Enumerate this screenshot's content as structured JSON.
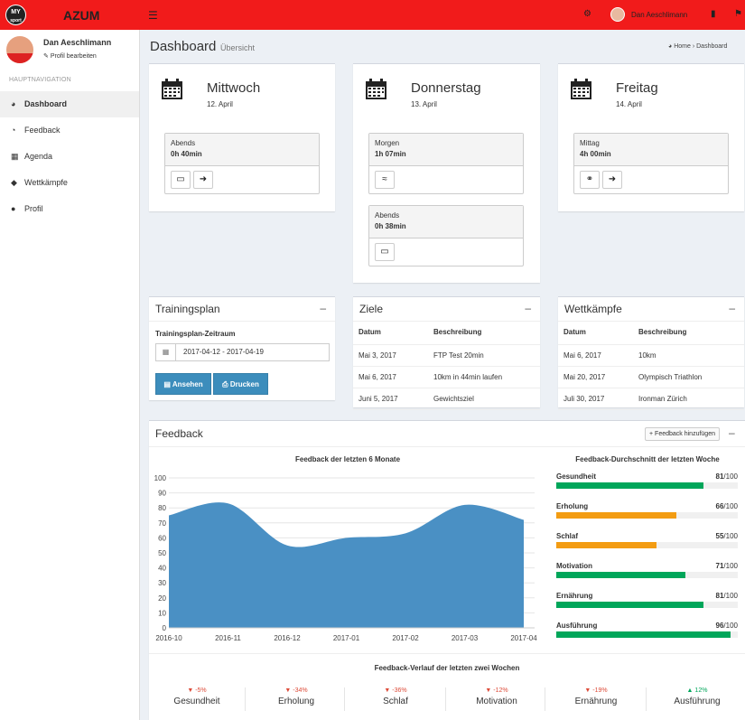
{
  "header": {
    "logo": "MY sport",
    "brand": "AZUM",
    "user_name": "Dan Aeschlimann"
  },
  "sidebar": {
    "user_name": "Dan Aeschlimann",
    "edit_profile": "Profil bearbeiten",
    "section": "HAUPTNAVIGATION",
    "items": [
      {
        "label": "Dashboard",
        "icon": "dashboard-icon",
        "active": true
      },
      {
        "label": "Feedback",
        "icon": "pie-chart-icon",
        "active": false
      },
      {
        "label": "Agenda",
        "icon": "calendar-icon",
        "active": false
      },
      {
        "label": "Wettkämpfe",
        "icon": "trophy-icon",
        "active": false
      },
      {
        "label": "Profil",
        "icon": "user-icon",
        "active": false
      }
    ]
  },
  "page": {
    "title": "Dashboard",
    "subtitle": "Übersicht",
    "crumb_home": "Home",
    "crumb_sep": "›",
    "crumb_current": "Dashboard"
  },
  "days": [
    {
      "name": "Mittwoch",
      "date": "12. April",
      "sessions": [
        {
          "label": "Abends",
          "duration": "0h 40min",
          "sports": [
            "dumbbell-icon",
            "running-icon"
          ]
        }
      ]
    },
    {
      "name": "Donnerstag",
      "date": "13. April",
      "sessions": [
        {
          "label": "Morgen",
          "duration": "1h 07min",
          "sports": [
            "swimming-icon"
          ]
        },
        {
          "label": "Abends",
          "duration": "0h 38min",
          "sports": [
            "dumbbell-icon"
          ]
        }
      ]
    },
    {
      "name": "Freitag",
      "date": "14. April",
      "sessions": [
        {
          "label": "Mittag",
          "duration": "4h 00min",
          "sports": [
            "bicycle-icon",
            "running-icon"
          ]
        }
      ]
    }
  ],
  "trainingsplan": {
    "title": "Trainingsplan",
    "label": "Trainingsplan-Zeitraum",
    "range": "2017-04-12 - 2017-04-19",
    "view_label": "Ansehen",
    "print_label": "Drucken"
  },
  "ziele": {
    "title": "Ziele",
    "columns": [
      "Datum",
      "Beschreibung"
    ],
    "rows": [
      [
        "Mai 3, 2017",
        "FTP Test 20min"
      ],
      [
        "Mai 6, 2017",
        "10km in 44min laufen"
      ],
      [
        "Juni 5, 2017",
        "Gewichtsziel"
      ]
    ]
  },
  "wettkaempfe": {
    "title": "Wettkämpfe",
    "columns": [
      "Datum",
      "Beschreibung"
    ],
    "rows": [
      [
        "Mai 6, 2017",
        "10km"
      ],
      [
        "Mai 20, 2017",
        "Olympisch Triathlon"
      ],
      [
        "Juli 30, 2017",
        "Ironman Zürich"
      ]
    ]
  },
  "feedback": {
    "title": "Feedback",
    "add_label": "Feedback hinzufügen",
    "chart_title": "Feedback der letzten 6 Monate",
    "avg_title": "Feedback-Durchschnitt der letzten Woche",
    "avg_suffix": "/100",
    "averages": [
      {
        "label": "Gesundheit",
        "value": 81,
        "color": "#00a65a"
      },
      {
        "label": "Erholung",
        "value": 66,
        "color": "#f39c12"
      },
      {
        "label": "Schlaf",
        "value": 55,
        "color": "#f39c12"
      },
      {
        "label": "Motivation",
        "value": 71,
        "color": "#00a65a"
      },
      {
        "label": "Ernährung",
        "value": 81,
        "color": "#00a65a"
      },
      {
        "label": "Ausführung",
        "value": 96,
        "color": "#00a65a"
      }
    ],
    "trend_title": "Feedback-Verlauf der letzten zwei Wochen",
    "trends": [
      {
        "name": "Gesundheit",
        "pct": "-5%",
        "dir": "down"
      },
      {
        "name": "Erholung",
        "pct": "-34%",
        "dir": "down"
      },
      {
        "name": "Schlaf",
        "pct": "-36%",
        "dir": "down"
      },
      {
        "name": "Motivation",
        "pct": "-12%",
        "dir": "down"
      },
      {
        "name": "Ernährung",
        "pct": "-19%",
        "dir": "down"
      },
      {
        "name": "Ausführung",
        "pct": "12%",
        "dir": "up"
      }
    ]
  },
  "chart_data": {
    "type": "area",
    "title": "Feedback der letzten 6 Monate",
    "x": [
      "2016-10",
      "2016-11",
      "2016-12",
      "2017-01",
      "2017-02",
      "2017-03",
      "2017-04"
    ],
    "values": [
      75,
      83,
      55,
      60,
      63,
      82,
      72
    ],
    "ylim": [
      0,
      100
    ],
    "yticks": [
      0,
      10,
      20,
      30,
      40,
      50,
      60,
      70,
      80,
      90,
      100
    ],
    "grid": true,
    "color": "#4a90c4"
  },
  "colors": {
    "topbar": "#f11b1b",
    "button": "#3c8dbc",
    "good": "#00a65a",
    "warn": "#f39c12",
    "down": "#dd4b39"
  }
}
